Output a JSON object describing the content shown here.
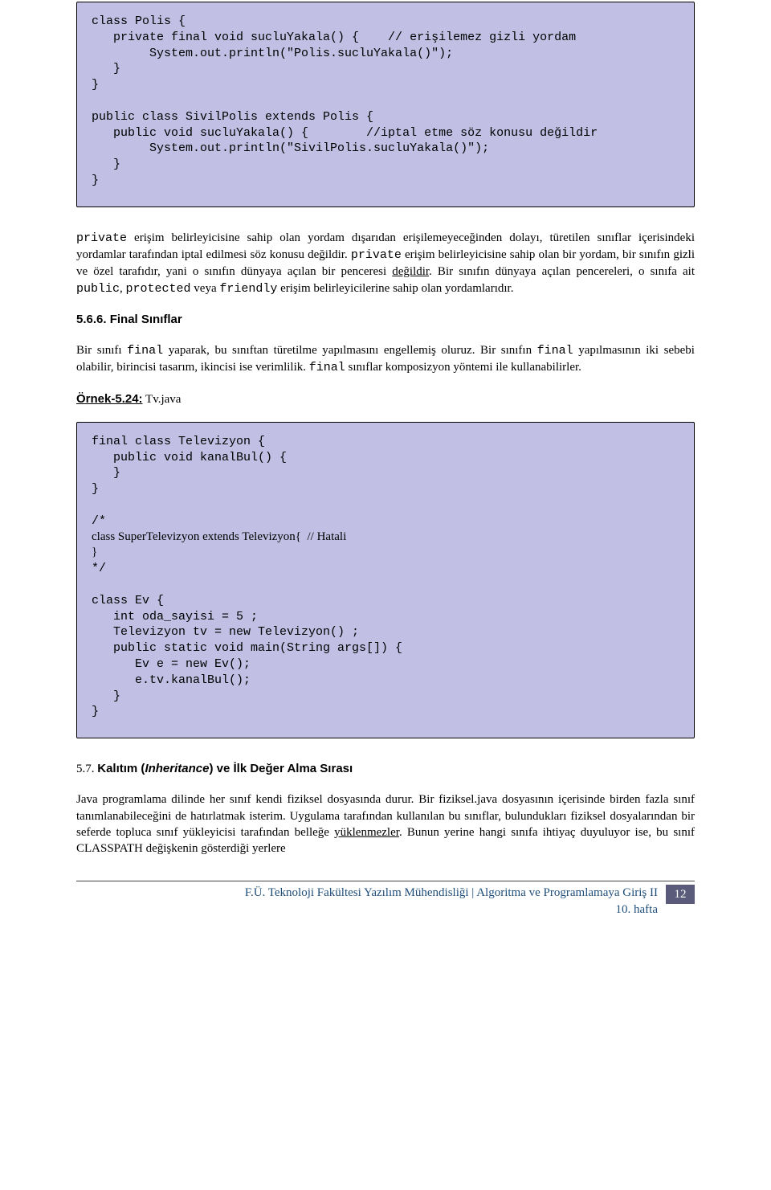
{
  "code1": {
    "l1": "class Polis {",
    "l2": "   private final void sucluYakala() {    // erişilemez gizli yordam",
    "l3": "        System.out.println(\"Polis.sucluYakala()\");",
    "l4": "   }",
    "l5": "}",
    "l6": "",
    "l7": "public class SivilPolis extends Polis {",
    "l8": "   public void sucluYakala() {        //iptal etme söz konusu değildir",
    "l9": "        System.out.println(\"SivilPolis.sucluYakala()\");",
    "l10": "   }",
    "l11": "}"
  },
  "para1": {
    "a": "private",
    "b": " erişim belirleyicisine sahip olan yordam dışarıdan erişilemeyeceğinden dolayı, türetilen sınıflar içerisindeki yordamlar tarafından iptal edilmesi söz konusu değildir. ",
    "c": "private",
    "d": " erişim belirleyicisine sahip olan bir yordam, bir sınıfın gizli ve özel tarafıdır, yani o sınıfın dünyaya açılan bir penceresi ",
    "e": "değildir",
    "f": ". Bir sınıfın dünyaya açılan pencereleri, o sınıfa ait ",
    "g": "public",
    "h": ", ",
    "i": "protected",
    "j": " veya ",
    "k": "friendly",
    "l": " erişim belirleyicilerine sahip olan yordamlarıdır."
  },
  "heading566": "5.6.6. Final Sınıflar",
  "para2": {
    "a": "Bir sınıfı ",
    "b": "final",
    "c": " yaparak, bu sınıftan türetilme yapılmasını engellemiş oluruz. Bir sınıfın ",
    "d": "final",
    "e": " yapılmasının iki sebebi olabilir, birincisi tasarım, ikincisi ise verimlilik. ",
    "f": "final",
    "g": " sınıflar komposizyon yöntemi ile kullanabilirler."
  },
  "example_label": "Örnek-5.24:",
  "example_file": " Tv.java",
  "code2": {
    "l1": "final class Televizyon {",
    "l2": "   public void kanalBul() {",
    "l3": "   }",
    "l4": "}",
    "l5": "",
    "l6": "/*",
    "l7": "class SuperTelevizyon extends Televizyon{  // Hatali",
    "l8": "}",
    "l9": "*/",
    "l10": "",
    "l11": "class Ev {",
    "l12": "   int oda_sayisi = 5 ;",
    "l13": "   Televizyon tv = new Televizyon() ;",
    "l14": "   public static void main(String args[]) {",
    "l15": "      Ev e = new Ev();",
    "l16": "      e.tv.kanalBul();",
    "l17": "   }",
    "l18": "}"
  },
  "heading57_num": "5.7.  ",
  "heading57_a": "Kalıtım (",
  "heading57_italic": "Inheritance",
  "heading57_b": ") ve İlk Değer Alma Sırası",
  "para3": {
    "a": "Java programlama dilinde her sınıf kendi fiziksel dosyasında durur. Bir fiziksel.java dosyasının içerisinde birden fazla sınıf tanımlanabileceğini de hatırlatmak isterim. Uygulama tarafından kullanılan bu sınıflar, bulundukları fiziksel dosyalarından bir seferde topluca sınıf yükleyicisi tarafından belleğe ",
    "b": "yüklenmezler",
    "c": ". Bunun yerine hangi sınıfa ihtiyaç duyuluyor ise, bu sınıf CLASSPATH değişkenin gösterdiği yerlere"
  },
  "footer": {
    "line1": "F.Ü. Teknoloji Fakültesi Yazılım Mühendisliği | Algoritma ve Programlamaya Giriş II",
    "line2": "10. hafta",
    "page": "12"
  }
}
